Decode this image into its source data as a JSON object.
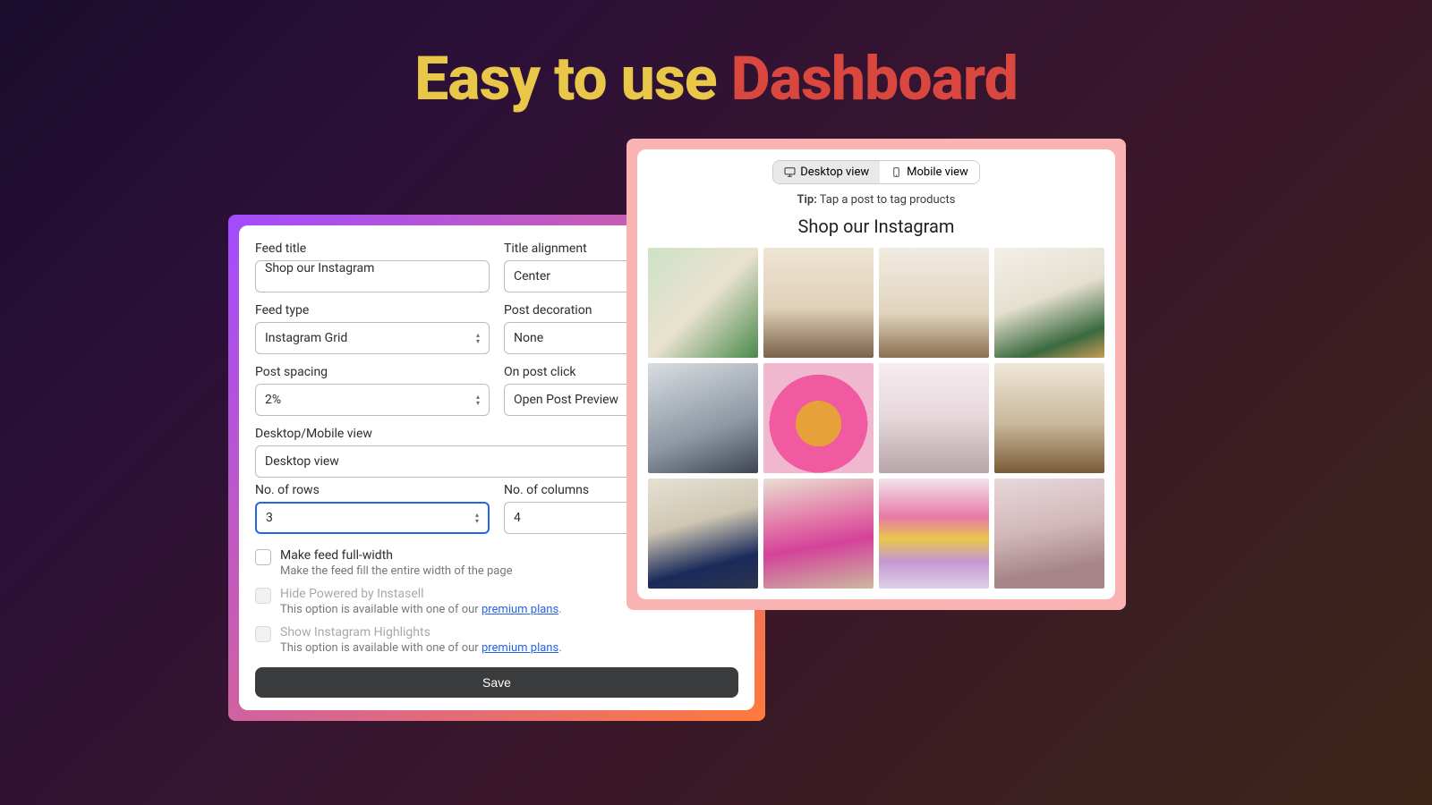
{
  "hero": {
    "part1": "Easy to use ",
    "part2": "Dashboard"
  },
  "form": {
    "feed_title": {
      "label": "Feed title",
      "value": "Shop our Instagram"
    },
    "title_alignment": {
      "label": "Title alignment",
      "value": "Center"
    },
    "feed_type": {
      "label": "Feed type",
      "value": "Instagram Grid"
    },
    "post_decoration": {
      "label": "Post decoration",
      "value": "None"
    },
    "post_spacing": {
      "label": "Post spacing",
      "value": "2%"
    },
    "on_post_click": {
      "label": "On post click",
      "value": "Open Post Preview"
    },
    "view": {
      "label": "Desktop/Mobile view",
      "value": "Desktop view"
    },
    "rows": {
      "label": "No. of rows",
      "value": "3"
    },
    "cols": {
      "label": "No. of columns",
      "value": "4"
    },
    "full_width": {
      "label": "Make feed full-width",
      "desc": "Make the feed fill the entire width of the page"
    },
    "hide_powered": {
      "label": "Hide Powered by Instasell",
      "desc_pre": "This option is available with one of our ",
      "link": "premium plans",
      "desc_post": "."
    },
    "show_highlights": {
      "label": "Show Instagram Highlights",
      "desc_pre": "This option is available with one of our ",
      "link": "premium plans",
      "desc_post": "."
    },
    "save": "Save"
  },
  "preview": {
    "desktop": "Desktop view",
    "mobile": "Mobile view",
    "tip_label": "Tip:",
    "tip_text": " Tap a post to tag products",
    "title": "Shop our Instagram"
  }
}
